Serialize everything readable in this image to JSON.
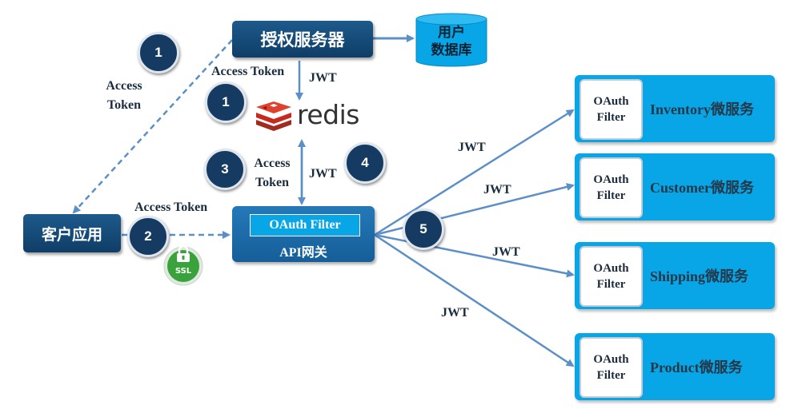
{
  "auth_server": {
    "label": "授权服务器"
  },
  "user_db": {
    "line1": "用户",
    "line2": "数据库"
  },
  "redis": {
    "label": "redis"
  },
  "client_app": {
    "label": "客户应用"
  },
  "gateway": {
    "filter_label": "OAuth Filter",
    "label": "API网关"
  },
  "ssl_badge": {
    "label": "SSL"
  },
  "steps": {
    "s1a": "1",
    "s1b": "1",
    "s2": "2",
    "s3": "3",
    "s4": "4",
    "s5": "5"
  },
  "labels": {
    "access_token_1a_l1": "Access",
    "access_token_1a_l2": "Token",
    "access_token_1b": "Access Token",
    "jwt_redis": "JWT",
    "access_token_3_l1": "Access",
    "access_token_3_l2": "Token",
    "jwt_4": "JWT",
    "access_token_2": "Access Token",
    "jwt_to_inventory": "JWT",
    "jwt_to_customer": "JWT",
    "jwt_to_shipping": "JWT",
    "jwt_to_product": "JWT"
  },
  "services": [
    {
      "filter_l1": "OAuth",
      "filter_l2": "Filter",
      "name": "Inventory微服务"
    },
    {
      "filter_l1": "OAuth",
      "filter_l2": "Filter",
      "name": "Customer微服务"
    },
    {
      "filter_l1": "OAuth",
      "filter_l2": "Filter",
      "name": "Shipping微服务"
    },
    {
      "filter_l1": "OAuth",
      "filter_l2": "Filter",
      "name": "Product微服务"
    }
  ],
  "colors": {
    "navy": "#163b62",
    "arrow": "#5b8fc7",
    "service_blue": "#08a6e6",
    "redis_red": "#d82c20",
    "ssl_green": "#3aa23a"
  }
}
